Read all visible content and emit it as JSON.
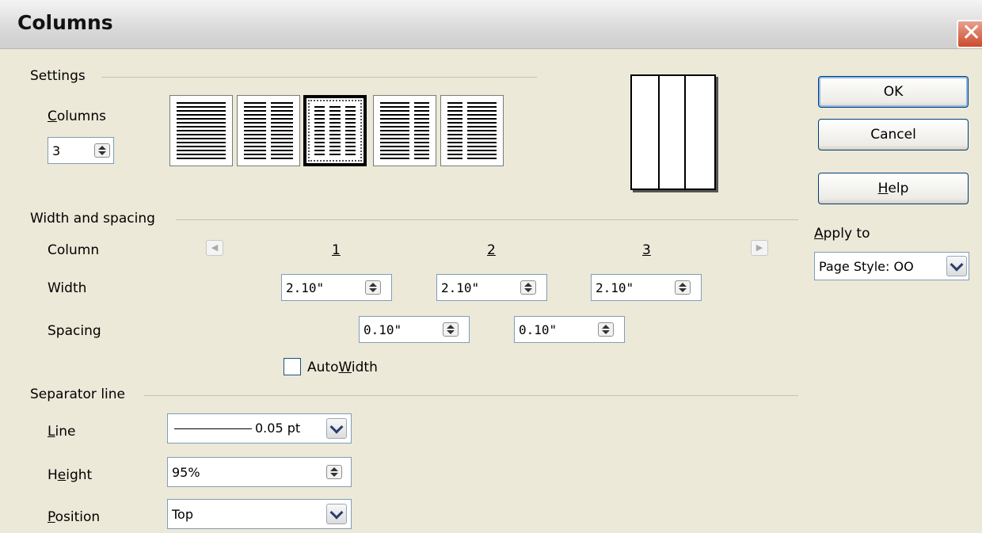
{
  "window": {
    "title": "Columns"
  },
  "settings": {
    "group_label": "Settings",
    "columns_label": "Columns",
    "columns_value": "3",
    "presets": [
      "1 column",
      "2 columns",
      "3 columns",
      "2 columns left wide",
      "2 columns right wide"
    ],
    "selected_preset": 2
  },
  "width_spacing": {
    "group_label": "Width and spacing",
    "column_label": "Column",
    "width_label": "Width",
    "spacing_label": "Spacing",
    "col_numbers": [
      "1",
      "2",
      "3"
    ],
    "widths": [
      "2.10\"",
      "2.10\"",
      "2.10\""
    ],
    "spacings": [
      "0.10\"",
      "0.10\""
    ],
    "autowidth_prefix": "Auto",
    "autowidth_key": "W",
    "autowidth_suffix": "idth",
    "autowidth_checked": false
  },
  "separator": {
    "group_label": "Separator line",
    "line_label": "Line",
    "line_value": "0.05 pt",
    "height_label_pre": "H",
    "height_label_key": "e",
    "height_label_post": "ight",
    "height_value": "95%",
    "position_label": "Position",
    "position_value": "Top"
  },
  "buttons": {
    "ok": "OK",
    "cancel": "Cancel",
    "help": "Help"
  },
  "apply_to": {
    "label": "Apply to",
    "value": "Page Style: OO"
  },
  "icons": {
    "close": "close-icon",
    "prev": "arrow-left-icon",
    "next": "arrow-right-icon"
  }
}
